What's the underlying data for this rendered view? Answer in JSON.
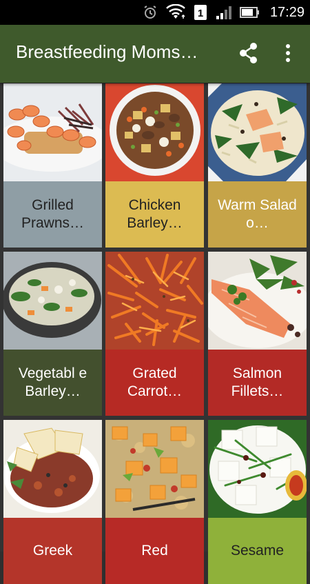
{
  "status_bar": {
    "time": "17:29",
    "icons": [
      "alarm-icon",
      "wifi-icon",
      "sim-1-icon",
      "signal-icon",
      "battery-icon"
    ]
  },
  "toolbar": {
    "title": "Breastfeeding Moms…",
    "share_icon": "share-icon",
    "menu_icon": "more-vert-icon"
  },
  "recipes": [
    {
      "label": "Grilled Prawns…",
      "color": "#8f9ea5",
      "text_color": "dark"
    },
    {
      "label": "Chicken Barley…",
      "color": "#dcbb52",
      "text_color": "dark"
    },
    {
      "label": "Warm Salad o…",
      "color": "#c6a448",
      "text_color": "light"
    },
    {
      "label": "Vegetabl e Barley…",
      "color": "#43502e",
      "text_color": "light"
    },
    {
      "label": "Grated Carrot…",
      "color": "#b62a24",
      "text_color": "light"
    },
    {
      "label": "Salmon Fillets…",
      "color": "#b32a26",
      "text_color": "light"
    },
    {
      "label": "Greek",
      "color": "#b4352a",
      "text_color": "light"
    },
    {
      "label": "Red",
      "color": "#b72a26",
      "text_color": "light"
    },
    {
      "label": "Sesame",
      "color": "#8fb13a",
      "text_color": "dark"
    }
  ]
}
